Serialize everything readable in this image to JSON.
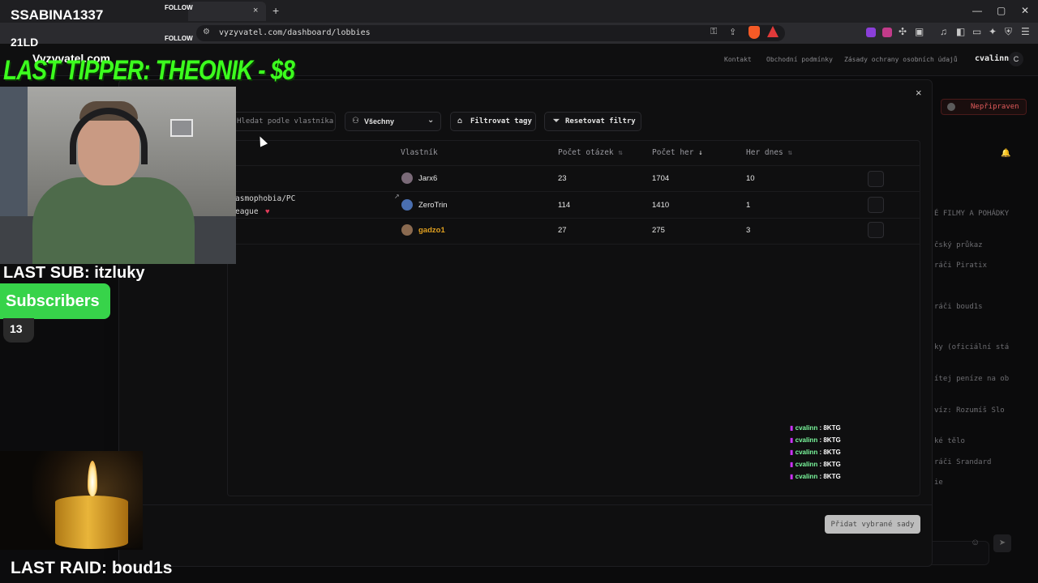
{
  "browser": {
    "tab_close": "×",
    "new_tab": "+",
    "url": "vyzyvatel.com/dashboard/lobbies",
    "window_controls": [
      "—",
      "▢",
      "✕"
    ]
  },
  "site": {
    "header_links": [
      "Kontakt",
      "Obchodní podmínky",
      "Zásady ochrany osobních údajů"
    ],
    "username": "cvalinn",
    "avatar_letter": "C"
  },
  "background": {
    "status_label": "Nepřipraven",
    "right_items": [
      "É FILMY A POHÁDKY",
      "čský průkaz",
      "ráči Piratix",
      "ráči boud1s",
      "ky (oficiální stá",
      "ítej peníze na ob",
      "víz: Rozumíš Slo",
      "ké tělo",
      "ráči Srandard",
      "ie"
    ]
  },
  "modal": {
    "close": "×",
    "search_placeholder": "Hledat podle vlastníka",
    "filter_owner": "Všechny",
    "filter_tags": "Filtrovat tagy",
    "reset_filters": "Resetovat filtry",
    "columns": {
      "owner": "Vlastník",
      "questions": "Počet otázek",
      "games": "Počet her",
      "games_today": "Her dnes"
    },
    "rows": [
      {
        "name": "",
        "owner": "Jarx6",
        "questions": "23",
        "games": "1704",
        "today": "10",
        "owner_color": "#e8e8e8",
        "avatar": "#7a6a78"
      },
      {
        "name_line1": "asmophobia/PC",
        "name_line2": "eague",
        "owner": "ZeroTrin",
        "questions": "114",
        "games": "1410",
        "today": "1",
        "owner_color": "#e8e8e8",
        "avatar": "#4a6fb0"
      },
      {
        "name": "",
        "owner": "gadzo1",
        "questions": "27",
        "games": "275",
        "today": "3",
        "owner_color": "#e0a020",
        "avatar": "#8a6a50"
      }
    ],
    "add_button": "Přidat vybrané sady"
  },
  "chat": {
    "lines": [
      {
        "user": "cvalinn",
        "msg": ": 8KTG"
      },
      {
        "user": "cvalinn",
        "msg": ": 8KTG"
      },
      {
        "user": "cvalinn",
        "msg": ": 8KTG"
      },
      {
        "user": "cvalinn",
        "msg": ": 8KTG"
      },
      {
        "user": "cvalinn",
        "msg": ": 8KTG"
      }
    ]
  },
  "overlay": {
    "streamer_name": "SSABINA1337",
    "follow_1": "FOLLOW",
    "follow_2": "FOLLOW",
    "sub_name": "21LD",
    "site_name": "Vyzyvatel.com",
    "last_tipper": "LAST TIPPER: THEONIK - $8",
    "last_sub": "LAST SUB: itzluky",
    "subscribers_label": "Subscribers",
    "subscribers_count": "13",
    "last_raid": "LAST RAID: boud1s"
  }
}
